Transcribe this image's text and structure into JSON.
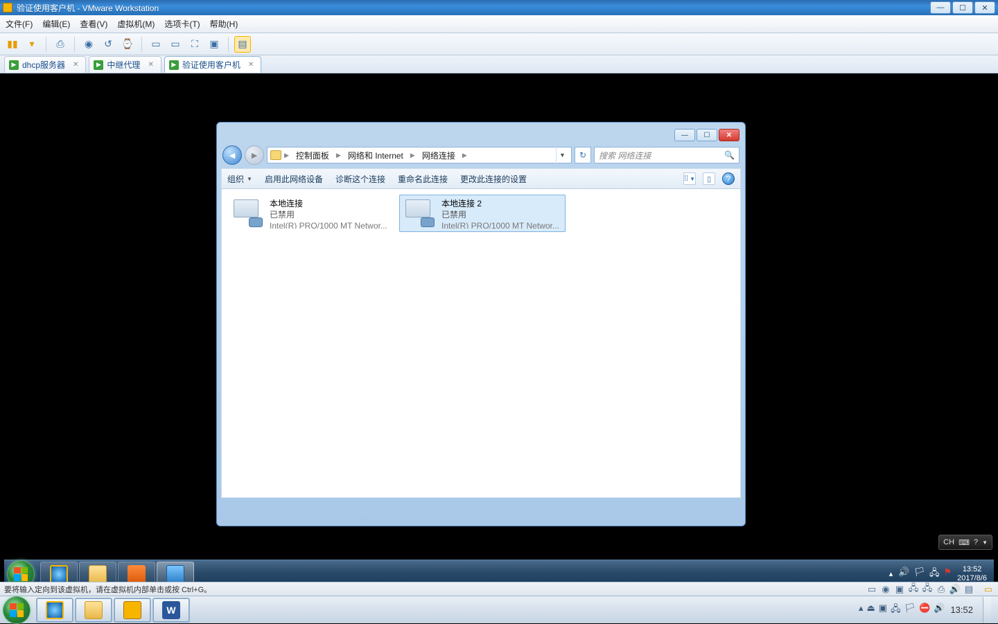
{
  "vmware": {
    "title": "验证使用客户机 - VMware Workstation",
    "menu": {
      "file": "文件(F)",
      "edit": "编辑(E)",
      "view": "查看(V)",
      "vm": "虚拟机(M)",
      "tabs": "选项卡(T)",
      "help": "帮助(H)"
    },
    "tabs": [
      {
        "label": "dhcp服务器",
        "active": false
      },
      {
        "label": "中继代理",
        "active": false
      },
      {
        "label": "验证使用客户机",
        "active": true
      }
    ],
    "status": "要将输入定向到该虚拟机，请在虚拟机内部单击或按 Ctrl+G。"
  },
  "guest": {
    "breadcrumb": {
      "root": "控制面板",
      "mid": "网络和 Internet",
      "leaf": "网络连接"
    },
    "search_placeholder": "搜索 网络连接",
    "cmdbar": {
      "organize": "组织",
      "enable": "启用此网络设备",
      "diagnose": "诊断这个连接",
      "rename": "重命名此连接",
      "change": "更改此连接的设置"
    },
    "connections": [
      {
        "name": "本地连接",
        "status": "已禁用",
        "device": "Intel(R) PRO/1000 MT Networ..."
      },
      {
        "name": "本地连接 2",
        "status": "已禁用",
        "device": "Intel(R) PRO/1000 MT Networ..."
      }
    ],
    "ime": "CH",
    "tray": {
      "time": "13:52",
      "date": "2017/8/6"
    }
  },
  "host_tray": {
    "time": "13:52"
  }
}
